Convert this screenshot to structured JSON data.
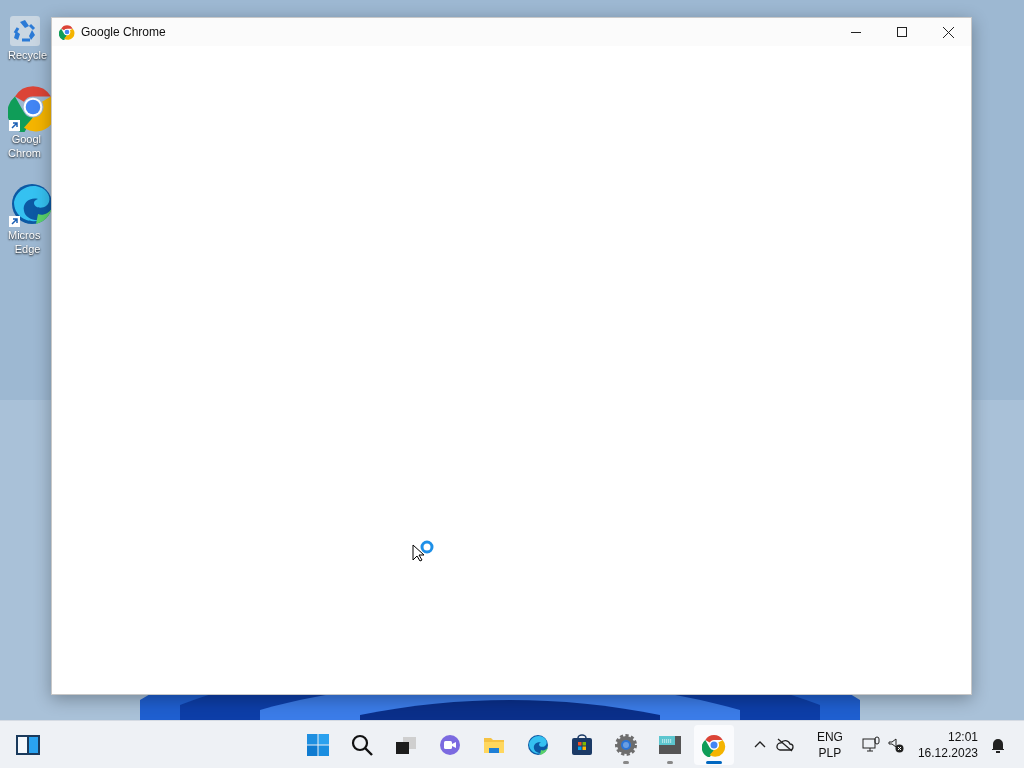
{
  "desktop_icons": [
    {
      "kind": "recycle",
      "lines": [
        "Recycle"
      ]
    },
    {
      "kind": "chrome",
      "lines": [
        "Googl",
        "Chrom"
      ]
    },
    {
      "kind": "edge",
      "lines": [
        "Micros",
        "Edge"
      ]
    }
  ],
  "window": {
    "title": "Google Chrome"
  },
  "taskbar": {
    "apps": [
      {
        "kind": "start",
        "running": false,
        "selected": false
      },
      {
        "kind": "search",
        "running": false,
        "selected": false
      },
      {
        "kind": "taskview",
        "running": false,
        "selected": false
      },
      {
        "kind": "chat",
        "running": false,
        "selected": false
      },
      {
        "kind": "files",
        "running": false,
        "selected": false
      },
      {
        "kind": "edge",
        "running": false,
        "selected": false
      },
      {
        "kind": "store",
        "running": false,
        "selected": false
      },
      {
        "kind": "settings",
        "running": true,
        "selected": false
      },
      {
        "kind": "terminal",
        "running": true,
        "selected": false
      },
      {
        "kind": "chrome",
        "running": true,
        "selected": true
      }
    ],
    "language": [
      "ENG",
      "PLP"
    ],
    "time": "12:01",
    "date": "16.12.2023"
  }
}
